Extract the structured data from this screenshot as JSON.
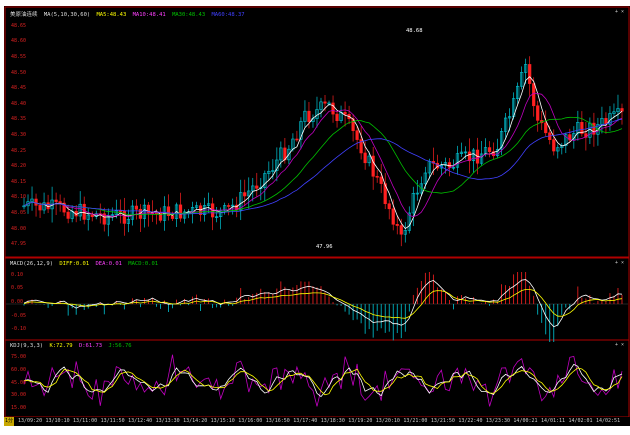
{
  "main_panel": {
    "legend": {
      "name": "美原油连续",
      "ma_params": "MA(5,10,30,60)",
      "ma5": "MA5:48.43",
      "ma10": "MA10:48.41",
      "ma30": "MA30:48.43",
      "ma60": "MA60:48.37"
    },
    "y_ticks": [
      "48.65",
      "48.60",
      "48.55",
      "48.50",
      "48.45",
      "48.40",
      "48.35",
      "48.30",
      "48.25",
      "48.20",
      "48.15",
      "48.10",
      "48.05",
      "48.00",
      "47.95"
    ],
    "peak_high_label": "48.68",
    "peak_low_label": "47.96",
    "button": "+ ×"
  },
  "macd_panel": {
    "legend": {
      "name": "MACD(26,12,9)",
      "dif": "DIFF:0.01",
      "dea": "DEA:0.01",
      "macd": "MACD:0.01"
    },
    "y_ticks": [
      "0.10",
      "0.05",
      "0.00",
      "-0.05",
      "-0.10"
    ],
    "button": "+ ×"
  },
  "kdj_panel": {
    "legend": {
      "name": "KDJ(9,3,3)",
      "k": "K:72.79",
      "d": "D:61.73",
      "j": "J:56.76"
    },
    "y_ticks": [
      "75.00",
      "60.00",
      "45.00",
      "30.00",
      "15.00"
    ],
    "button": "+ ×"
  },
  "x_axis": {
    "corner_label": "1分",
    "ticks": [
      "13/09:20",
      "13/10:10",
      "13/11:00",
      "13/11:50",
      "13/12:40",
      "13/13:30",
      "13/14:20",
      "13/15:10",
      "13/16:00",
      "13/16:50",
      "13/17:40",
      "13/18:30",
      "13/19:20",
      "13/20:10",
      "13/21:00",
      "13/21:50",
      "13/22:40",
      "13/23:30",
      "14/00:21",
      "14/01:11",
      "14/02:01",
      "14/02:51"
    ]
  },
  "colors": {
    "background": "#000000",
    "up_candle": "#00c8d8",
    "down_candle": "#ff2020",
    "ma5": "#ffffff",
    "ma10": "#ffff00",
    "ma30": "#00c000",
    "ma60": "#4040ff",
    "panel_border": "#b00000",
    "macd_up_bar": "#ff2020",
    "macd_down_bar": "#00c8d8",
    "dif_line": "#ffffff",
    "dea_line": "#ffff00",
    "k_line": "#ffffff",
    "d_line": "#ffff00",
    "j_line": "#c000c0"
  }
}
